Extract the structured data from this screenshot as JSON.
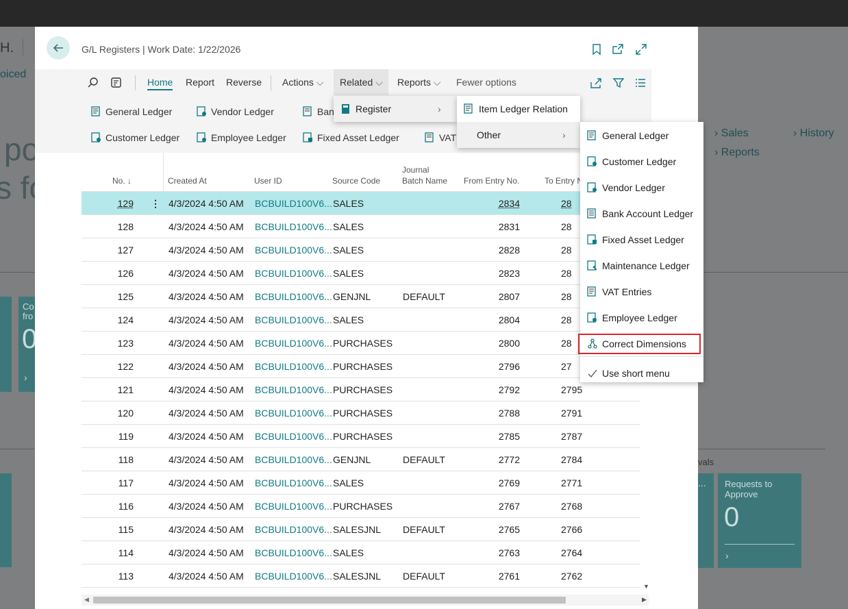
{
  "background": {
    "frag_h": "H.",
    "frag_oiced": "oiced",
    "frag_po": "po",
    "frag_sfo": "s fo",
    "links": [
      {
        "label": "Sales"
      },
      {
        "label": "Reports"
      },
      {
        "label": "History"
      }
    ],
    "tile_left_title": "Co\nfro",
    "tile_left_value": "0",
    "approvals_label": "vals",
    "tile_requests_title": "Requests to\nApprove",
    "tile_requests_value": "0",
    "tile_dots": "..."
  },
  "dialog": {
    "title": "G/L Registers | Work Date: 1/22/2026"
  },
  "actionbar": {
    "home": "Home",
    "report": "Report",
    "reverse": "Reverse",
    "actions": "Actions",
    "related": "Related",
    "reports": "Reports",
    "fewer": "Fewer options"
  },
  "promoted": {
    "general_ledger": "General Ledger",
    "vendor_ledger": "Vendor Ledger",
    "bank": "Bank",
    "customer_ledger": "Customer Ledger",
    "employee_ledger": "Employee Ledger",
    "fixed_asset_ledger": "Fixed Asset Ledger",
    "vat": "VAT"
  },
  "grid": {
    "headers": {
      "no": "No.",
      "created_at": "Created At",
      "user_id": "User ID",
      "source_code": "Source Code",
      "journal_batch_1": "Journal",
      "journal_batch_2": "Batch Name",
      "from_entry": "From Entry No.",
      "to_entry": "To Entry N"
    },
    "rows": [
      {
        "no": "129",
        "created": "4/3/2024 4:50 AM",
        "user": "BCBUILD100V6...",
        "source": "SALES",
        "batch": "",
        "from": "2834",
        "to": "28"
      },
      {
        "no": "128",
        "created": "4/3/2024 4:50 AM",
        "user": "BCBUILD100V6...",
        "source": "SALES",
        "batch": "",
        "from": "2831",
        "to": "28"
      },
      {
        "no": "127",
        "created": "4/3/2024 4:50 AM",
        "user": "BCBUILD100V6...",
        "source": "SALES",
        "batch": "",
        "from": "2828",
        "to": "28"
      },
      {
        "no": "126",
        "created": "4/3/2024 4:50 AM",
        "user": "BCBUILD100V6...",
        "source": "SALES",
        "batch": "",
        "from": "2823",
        "to": "28"
      },
      {
        "no": "125",
        "created": "4/3/2024 4:50 AM",
        "user": "BCBUILD100V6...",
        "source": "GENJNL",
        "batch": "DEFAULT",
        "from": "2807",
        "to": "28"
      },
      {
        "no": "124",
        "created": "4/3/2024 4:50 AM",
        "user": "BCBUILD100V6...",
        "source": "SALES",
        "batch": "",
        "from": "2804",
        "to": "28"
      },
      {
        "no": "123",
        "created": "4/3/2024 4:50 AM",
        "user": "BCBUILD100V6...",
        "source": "PURCHASES",
        "batch": "",
        "from": "2800",
        "to": "28"
      },
      {
        "no": "122",
        "created": "4/3/2024 4:50 AM",
        "user": "BCBUILD100V6...",
        "source": "PURCHASES",
        "batch": "",
        "from": "2796",
        "to": "27"
      },
      {
        "no": "121",
        "created": "4/3/2024 4:50 AM",
        "user": "BCBUILD100V6...",
        "source": "PURCHASES",
        "batch": "",
        "from": "2792",
        "to": "2795"
      },
      {
        "no": "120",
        "created": "4/3/2024 4:50 AM",
        "user": "BCBUILD100V6...",
        "source": "PURCHASES",
        "batch": "",
        "from": "2788",
        "to": "2791"
      },
      {
        "no": "119",
        "created": "4/3/2024 4:50 AM",
        "user": "BCBUILD100V6...",
        "source": "PURCHASES",
        "batch": "",
        "from": "2785",
        "to": "2787"
      },
      {
        "no": "118",
        "created": "4/3/2024 4:50 AM",
        "user": "BCBUILD100V6...",
        "source": "GENJNL",
        "batch": "DEFAULT",
        "from": "2772",
        "to": "2784"
      },
      {
        "no": "117",
        "created": "4/3/2024 4:50 AM",
        "user": "BCBUILD100V6...",
        "source": "SALES",
        "batch": "",
        "from": "2769",
        "to": "2771"
      },
      {
        "no": "116",
        "created": "4/3/2024 4:50 AM",
        "user": "BCBUILD100V6...",
        "source": "PURCHASES",
        "batch": "",
        "from": "2767",
        "to": "2768"
      },
      {
        "no": "115",
        "created": "4/3/2024 4:50 AM",
        "user": "BCBUILD100V6...",
        "source": "SALESJNL",
        "batch": "DEFAULT",
        "from": "2765",
        "to": "2766"
      },
      {
        "no": "114",
        "created": "4/3/2024 4:50 AM",
        "user": "BCBUILD100V6...",
        "source": "SALES",
        "batch": "",
        "from": "2763",
        "to": "2764"
      },
      {
        "no": "113",
        "created": "4/3/2024 4:50 AM",
        "user": "BCBUILD100V6...",
        "source": "SALESJNL",
        "batch": "DEFAULT",
        "from": "2761",
        "to": "2762"
      }
    ]
  },
  "menus": {
    "related": [
      {
        "label": "Register"
      }
    ],
    "register": [
      {
        "label": "Item Ledger Relation"
      },
      {
        "label": "Other"
      }
    ],
    "other": [
      {
        "label": "General Ledger",
        "icon": "ledger-icon"
      },
      {
        "label": "Customer Ledger",
        "icon": "customer-ledger-icon"
      },
      {
        "label": "Vendor Ledger",
        "icon": "vendor-ledger-icon"
      },
      {
        "label": "Bank Account Ledger",
        "icon": "bank-ledger-icon"
      },
      {
        "label": "Fixed Asset Ledger",
        "icon": "fixed-asset-ledger-icon"
      },
      {
        "label": "Maintenance Ledger",
        "icon": "maintenance-ledger-icon"
      },
      {
        "label": "VAT Entries",
        "icon": "vat-entries-icon"
      },
      {
        "label": "Employee Ledger",
        "icon": "employee-ledger-icon"
      },
      {
        "label": "Correct Dimensions",
        "icon": "correct-dimensions-icon"
      },
      {
        "label": "Use short menu",
        "icon": "check-icon"
      }
    ]
  },
  "colors": {
    "accent": "#117a86",
    "selected_row": "#b5e8ea",
    "highlight_border": "#d9262c"
  }
}
